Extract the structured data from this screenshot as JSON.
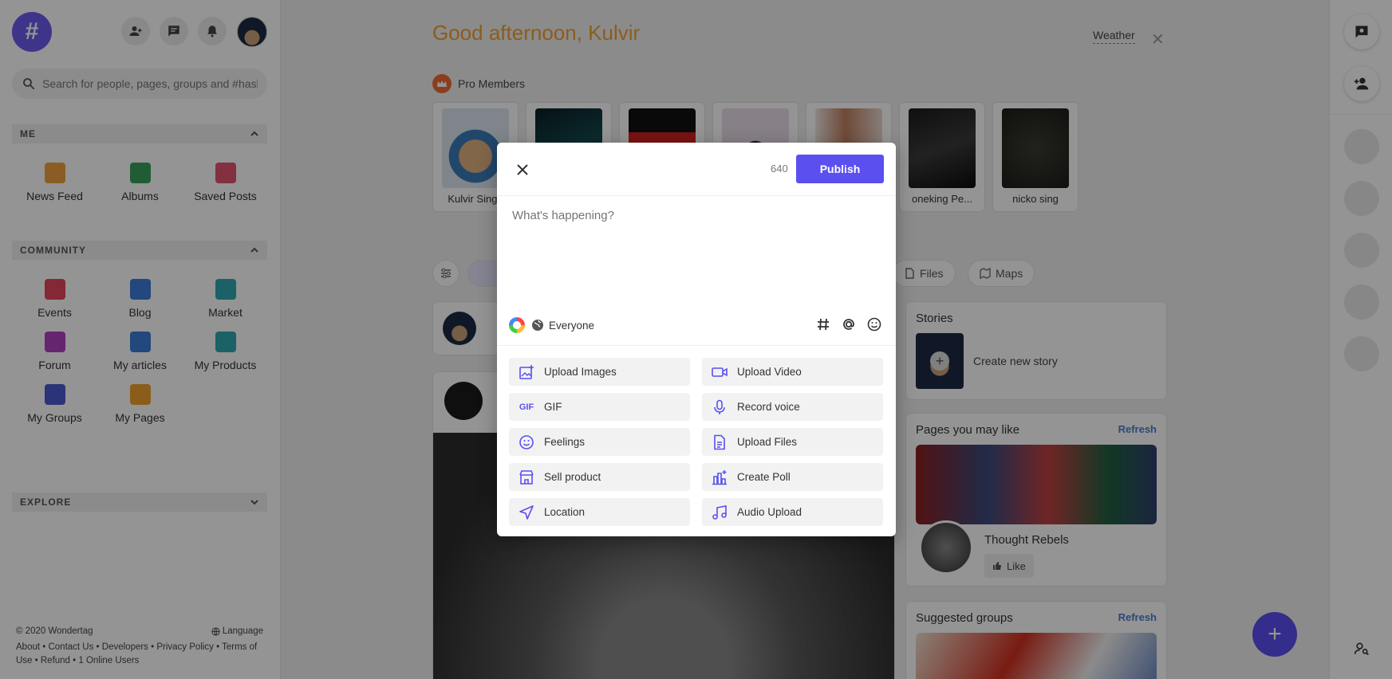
{
  "left": {
    "search_placeholder": "Search for people, pages, groups and #hashtags",
    "me_section": "ME",
    "me_items": [
      {
        "label": "News Feed",
        "icon": "news-feed-icon",
        "color": "#f0a040"
      },
      {
        "label": "Albums",
        "icon": "albums-icon",
        "color": "#3aa05a"
      },
      {
        "label": "Saved Posts",
        "icon": "bookmark-icon",
        "color": "#e25370"
      }
    ],
    "community_section": "COMMUNITY",
    "community_items": [
      {
        "label": "Events",
        "icon": "calendar-icon",
        "color": "#e2455b"
      },
      {
        "label": "Blog",
        "icon": "blog-icon",
        "color": "#3b7dd8"
      },
      {
        "label": "Market",
        "icon": "market-icon",
        "color": "#2fa7b0"
      },
      {
        "label": "Forum",
        "icon": "forum-icon",
        "color": "#b040c0"
      },
      {
        "label": "My articles",
        "icon": "articles-icon",
        "color": "#3b7dd8"
      },
      {
        "label": "My Products",
        "icon": "shopping-bag-icon",
        "color": "#2fa7b0"
      },
      {
        "label": "My Groups",
        "icon": "groups-icon",
        "color": "#4a5bd0"
      },
      {
        "label": "My Pages",
        "icon": "flag-icon",
        "color": "#f0a030"
      }
    ],
    "explore_section": "EXPLORE",
    "footer": {
      "copyright": "© 2020 Wondertag",
      "language": "Language",
      "links": "About • Contact Us • Developers • Privacy Policy • Terms of Use • Refund • 1 Online Users"
    }
  },
  "main": {
    "greeting": "Good afternoon, Kulvir",
    "weather": "Weather",
    "pro_members_label": "Pro Members",
    "pro_members": [
      "Kulvir Singh",
      "",
      "",
      "",
      "",
      "oneking Pe...",
      "nicko sing"
    ],
    "filters": {
      "files": "Files",
      "maps": "Maps"
    }
  },
  "widgets": {
    "stories_title": "Stories",
    "create_story": "Create new story",
    "pages_title": "Pages you may like",
    "refresh": "Refresh",
    "page_name": "Thought Rebels",
    "like": "Like",
    "groups_title": "Suggested groups"
  },
  "modal": {
    "char_count": "640",
    "publish": "Publish",
    "placeholder": "What's happening?",
    "privacy": "Everyone",
    "actions": [
      {
        "label": "Upload Images",
        "icon": "image-upload-icon"
      },
      {
        "label": "Upload Video",
        "icon": "video-icon"
      },
      {
        "label": "GIF",
        "icon": "gif-icon"
      },
      {
        "label": "Record voice",
        "icon": "microphone-icon"
      },
      {
        "label": "Feelings",
        "icon": "smiley-icon"
      },
      {
        "label": "Upload Files",
        "icon": "file-upload-icon"
      },
      {
        "label": "Sell product",
        "icon": "store-icon"
      },
      {
        "label": "Create Poll",
        "icon": "poll-icon"
      },
      {
        "label": "Location",
        "icon": "location-arrow-icon"
      },
      {
        "label": "Audio Upload",
        "icon": "music-note-icon"
      }
    ],
    "gif_text": "GIF"
  },
  "colors": {
    "accent": "#5b4ff0",
    "greeting": "#f0a030",
    "refresh": "#4a7bd0"
  }
}
